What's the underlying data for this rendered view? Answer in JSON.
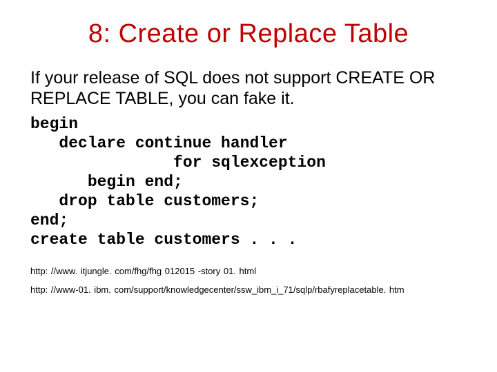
{
  "slide": {
    "title": "8: Create or Replace Table",
    "body": "If your release of SQL does not support CREATE OR REPLACE TABLE, you can fake it.",
    "code": "begin\n   declare continue handler\n               for sqlexception\n      begin end;\n   drop table customers;\nend;\ncreate table customers . . .",
    "links": [
      "http: //www. itjungle. com/fhg/fhg 012015 -story 01. html",
      "http: //www-01. ibm. com/support/knowledgecenter/ssw_ibm_i_71/sqlp/rbafyreplacetable. htm"
    ]
  }
}
